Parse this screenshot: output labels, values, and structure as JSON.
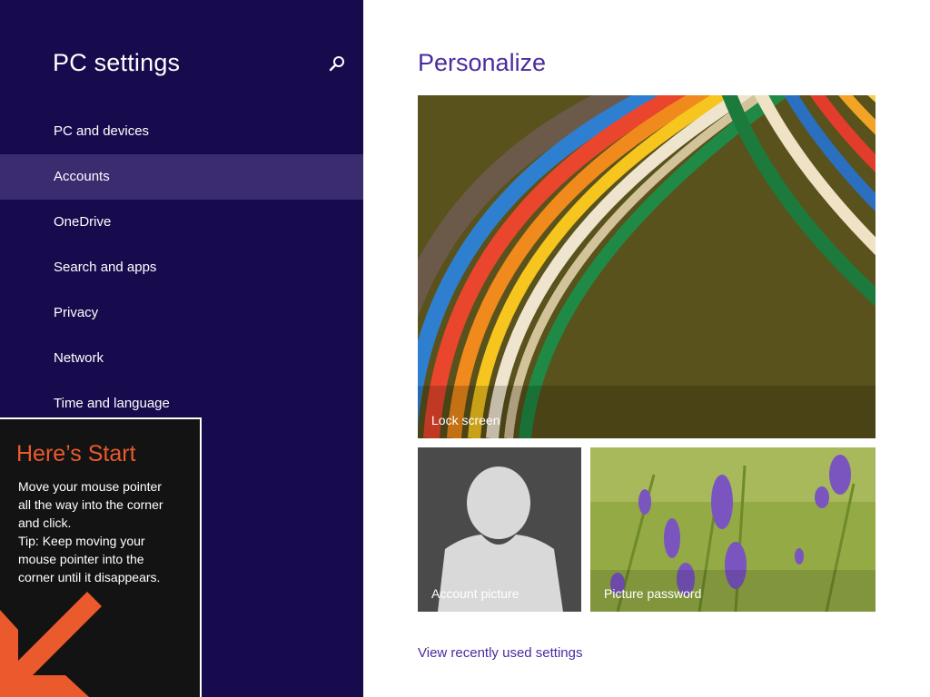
{
  "sidebar": {
    "title": "PC settings",
    "search_icon": "search-icon",
    "items": [
      {
        "label": "PC and devices",
        "selected": false
      },
      {
        "label": "Accounts",
        "selected": true
      },
      {
        "label": "OneDrive",
        "selected": false
      },
      {
        "label": "Search and apps",
        "selected": false
      },
      {
        "label": "Privacy",
        "selected": false
      },
      {
        "label": "Network",
        "selected": false
      },
      {
        "label": "Time and language",
        "selected": false
      }
    ]
  },
  "main": {
    "title": "Personalize",
    "tiles": {
      "lock_screen": "Lock screen",
      "account_picture": "Account picture",
      "picture_password": "Picture password"
    },
    "recent_link": "View recently used settings"
  },
  "start_tip": {
    "title": "Here’s Start",
    "body": "Move your mouse pointer\nall the way into the corner\nand click.\nTip: Keep moving your\nmouse pointer into the\ncorner until it disappears.",
    "arrow_icon": "arrow-down-left-icon"
  },
  "colors": {
    "sidebar_bg": "#180b4d",
    "selected_item_bg": "#3b2b6f",
    "accent_purple": "#4a2c9e",
    "tip_accent_orange": "#ea5a2c",
    "tip_bg": "#131313"
  }
}
